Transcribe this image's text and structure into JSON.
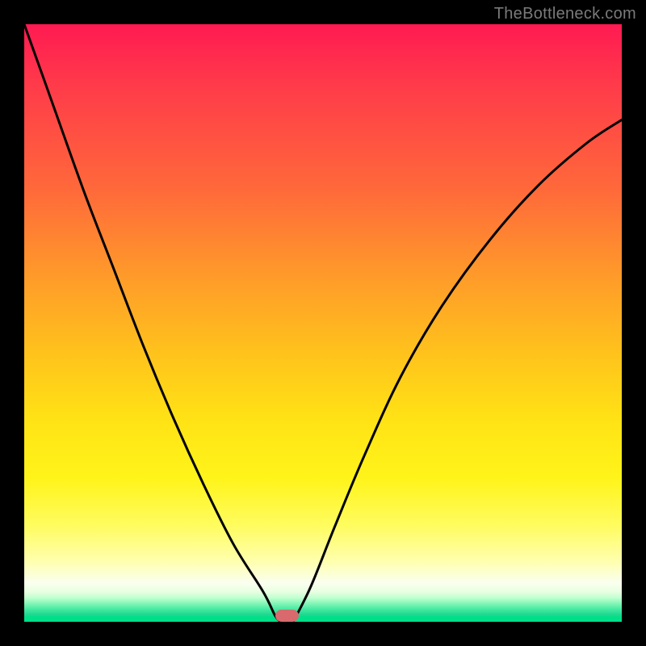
{
  "watermark": "TheBottleneck.com",
  "colors": {
    "frame": "#000000",
    "curve": "#000000",
    "marker": "#d86a6e",
    "gradient_top": "#ff1a52",
    "gradient_bottom": "#00e089"
  },
  "chart_data": {
    "type": "line",
    "title": "",
    "xlabel": "",
    "ylabel": "",
    "xlim": [
      0,
      100
    ],
    "ylim": [
      0,
      100
    ],
    "grid": false,
    "legend": false,
    "series": [
      {
        "name": "left-curve",
        "x": [
          0,
          5,
          10,
          15,
          20,
          25,
          30,
          35,
          40,
          42,
          43
        ],
        "values": [
          100,
          86,
          72,
          59,
          46,
          34,
          23,
          13,
          5,
          1,
          0
        ]
      },
      {
        "name": "right-curve",
        "x": [
          45,
          48,
          52,
          57,
          63,
          70,
          78,
          86,
          94,
          100
        ],
        "values": [
          0,
          6,
          16,
          28,
          41,
          53,
          64,
          73,
          80,
          84
        ]
      }
    ],
    "marker": {
      "x_center": 44,
      "width": 4,
      "height": 2
    },
    "annotations": []
  }
}
